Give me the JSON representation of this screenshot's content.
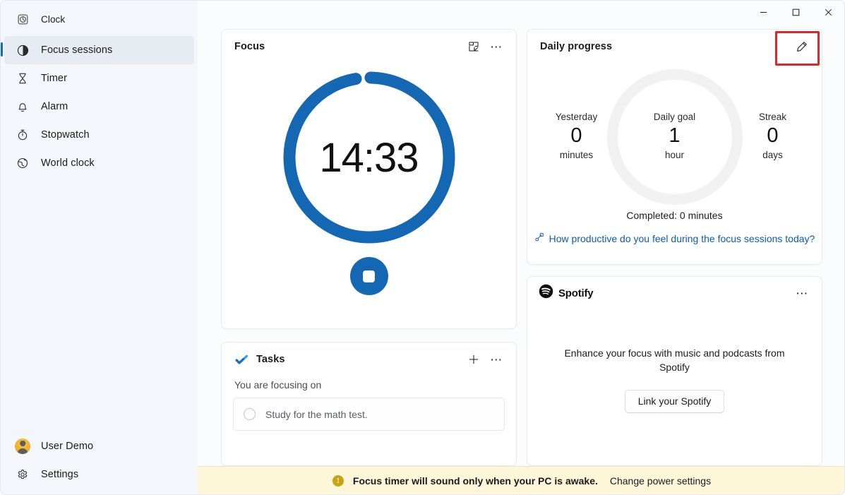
{
  "window": {
    "app_title": "Clock",
    "controls": {
      "minimize": "Minimize",
      "maximize": "Maximize",
      "close": "Close"
    }
  },
  "sidebar": {
    "items": [
      {
        "label": "Focus sessions",
        "icon": "focus-sessions-icon",
        "active": true
      },
      {
        "label": "Timer",
        "icon": "timer-icon",
        "active": false
      },
      {
        "label": "Alarm",
        "icon": "alarm-icon",
        "active": false
      },
      {
        "label": "Stopwatch",
        "icon": "stopwatch-icon",
        "active": false
      },
      {
        "label": "World clock",
        "icon": "world-clock-icon",
        "active": false
      }
    ],
    "user": {
      "label": "User Demo"
    },
    "settings": {
      "label": "Settings"
    }
  },
  "focus_card": {
    "title": "Focus",
    "time_remaining": "14:33",
    "ring_progress_percent": 97,
    "mini_view_icon": "mini-view-icon",
    "more_icon": "more-options-icon",
    "stop_button_label": "Stop focus session"
  },
  "tasks_card": {
    "title": "Tasks",
    "subtitle": "You are focusing on",
    "add_icon": "add-task-icon",
    "more_icon": "more-options-icon",
    "items": [
      {
        "text": "Study for the math test.",
        "done": false
      }
    ]
  },
  "daily_progress_card": {
    "title": "Daily progress",
    "edit_icon": "edit-pencil-icon",
    "stats": [
      {
        "label": "Yesterday",
        "value": "0",
        "unit": "minutes"
      },
      {
        "label": "Daily goal",
        "value": "1",
        "unit": "hour"
      },
      {
        "label": "Streak",
        "value": "0",
        "unit": "days"
      }
    ],
    "completed": "Completed: 0 minutes",
    "feedback_link": "How productive do you feel during the focus sessions today?",
    "feedback_icon": "feedback-icon",
    "highlight_color": "#d42c2c"
  },
  "spotify_card": {
    "brand": "Spotify",
    "logo_icon": "spotify-logo-icon",
    "more_icon": "more-options-icon",
    "description": "Enhance your focus with music and podcasts from Spotify",
    "link_button": "Link your Spotify"
  },
  "notification": {
    "icon": "warning-info-icon",
    "message": "Focus timer will sound only when your PC is awake.",
    "action": "Change power settings"
  },
  "colors": {
    "accent_blue": "#1467b3",
    "ring_track": "#f1f1f1",
    "sidebar_bg": "#f3f6fb",
    "notif_bg": "#fdf6d8",
    "link_blue": "#0b5cb5"
  }
}
